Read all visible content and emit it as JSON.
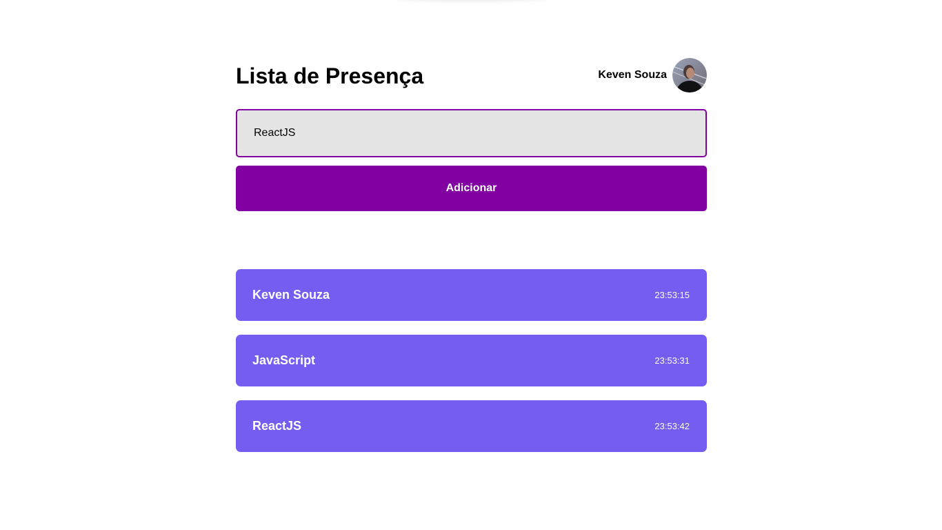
{
  "header": {
    "title": "Lista de Presença",
    "user": {
      "name": "Keven Souza",
      "avatar": "user-avatar"
    }
  },
  "form": {
    "input_value": "ReactJS",
    "button_label": "Adicionar"
  },
  "students": [
    {
      "name": "Keven Souza",
      "time": "23:53:15"
    },
    {
      "name": "JavaScript",
      "time": "23:53:31"
    },
    {
      "name": "ReactJS",
      "time": "23:53:42"
    }
  ],
  "colors": {
    "primary": "#82009f",
    "card": "#745df0",
    "input_bg": "#e5e5e5"
  }
}
